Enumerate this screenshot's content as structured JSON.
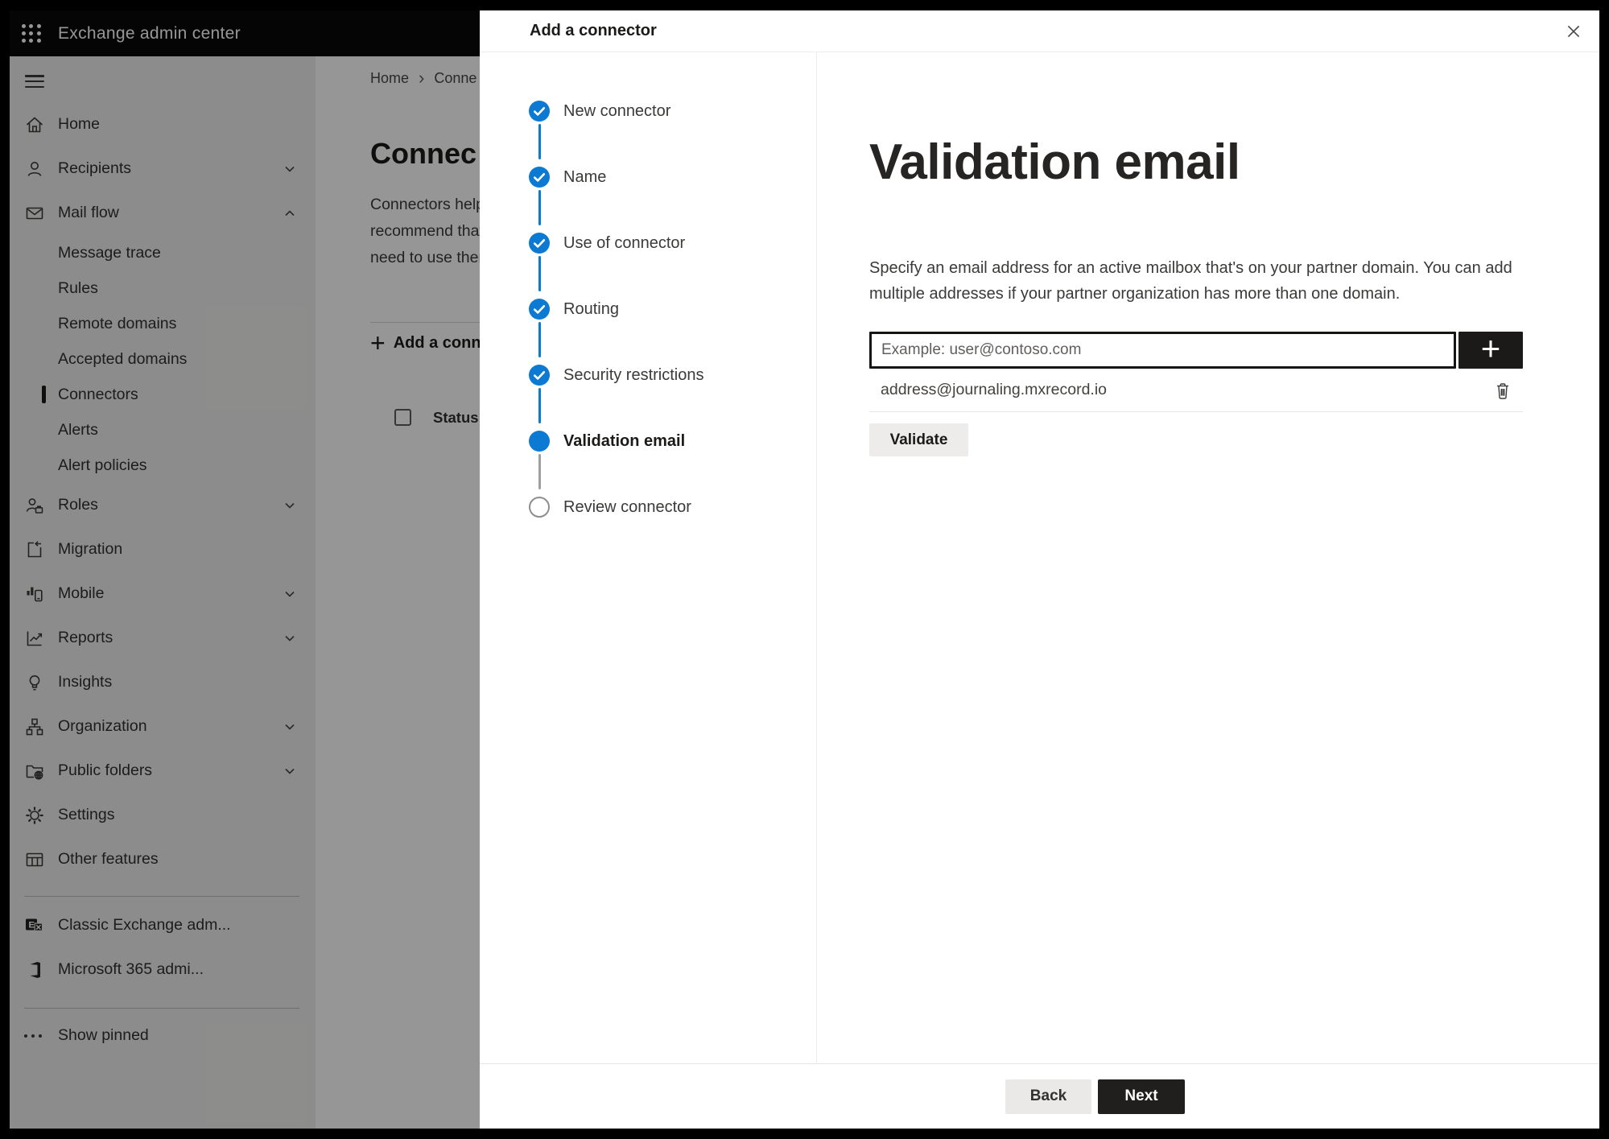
{
  "colors": {
    "accent": "#0c79d2",
    "topbar-bg": "#0a0a0a",
    "dark-btn": "#201f1e",
    "light-btn": "#edebe9"
  },
  "topbar": {
    "app_title": "Exchange admin center"
  },
  "sidebar": {
    "items": [
      {
        "label": "Home",
        "icon": "home"
      },
      {
        "label": "Recipients",
        "icon": "person",
        "chevron": "down"
      },
      {
        "label": "Mail flow",
        "icon": "mail",
        "chevron": "up"
      },
      {
        "label": "Message trace",
        "sub": true
      },
      {
        "label": "Rules",
        "sub": true
      },
      {
        "label": "Remote domains",
        "sub": true
      },
      {
        "label": "Accepted domains",
        "sub": true
      },
      {
        "label": "Connectors",
        "sub": true,
        "selected": true
      },
      {
        "label": "Alerts",
        "sub": true
      },
      {
        "label": "Alert policies",
        "sub": true
      },
      {
        "label": "Roles",
        "icon": "roles",
        "chevron": "down"
      },
      {
        "label": "Migration",
        "icon": "migration"
      },
      {
        "label": "Mobile",
        "icon": "mobile",
        "chevron": "down"
      },
      {
        "label": "Reports",
        "icon": "reports",
        "chevron": "down"
      },
      {
        "label": "Insights",
        "icon": "insights"
      },
      {
        "label": "Organization",
        "icon": "organization",
        "chevron": "down"
      },
      {
        "label": "Public folders",
        "icon": "public-folders",
        "chevron": "down"
      },
      {
        "label": "Settings",
        "icon": "settings"
      },
      {
        "label": "Other features",
        "icon": "other-features"
      },
      {
        "label": "Classic Exchange adm...",
        "icon": "exchange-logo"
      },
      {
        "label": "Microsoft 365 admi...",
        "icon": "office-logo"
      },
      {
        "label": "Show pinned",
        "icon": "ellipsis"
      }
    ]
  },
  "page": {
    "breadcrumb": {
      "home": "Home",
      "current": "Conne"
    },
    "title": "Connec",
    "intro_lines": [
      "Connectors help",
      "recommend that",
      "need to use ther"
    ],
    "add_button_label": "Add a conn",
    "table": {
      "status_header": "Status"
    }
  },
  "dialog": {
    "title": "Add a connector",
    "steps": [
      {
        "label": "New connector",
        "state": "complete"
      },
      {
        "label": "Name",
        "state": "complete"
      },
      {
        "label": "Use of connector",
        "state": "complete"
      },
      {
        "label": "Routing",
        "state": "complete"
      },
      {
        "label": "Security restrictions",
        "state": "complete"
      },
      {
        "label": "Validation email",
        "state": "current"
      },
      {
        "label": "Review connector",
        "state": "upcoming"
      }
    ],
    "content": {
      "heading": "Validation email",
      "description_lines": [
        "Specify an email address for an active mailbox that's on your partner domain. You can add",
        "multiple addresses if your partner organization has more than one domain."
      ],
      "email_input_placeholder": "Example: user@contoso.com",
      "added_addresses": [
        "address@journaling.mxrecord.io"
      ],
      "validate_button": "Validate"
    },
    "footer": {
      "back": "Back",
      "next": "Next"
    }
  },
  "icons": {
    "plus": "+",
    "breadcrumb_separator": "›"
  }
}
